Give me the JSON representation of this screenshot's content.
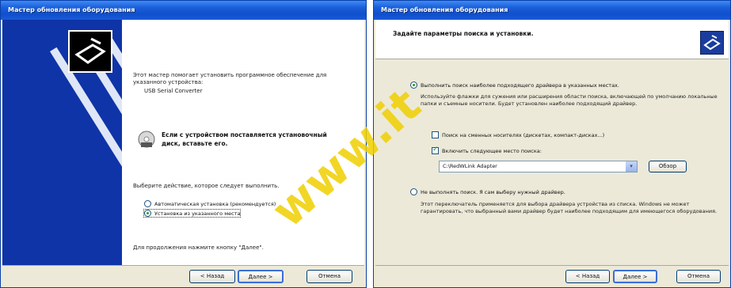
{
  "left_dialog": {
    "title": "Мастер обновления оборудования",
    "intro": "Этот мастер помогает установить программное обеспечение для указанного устройства:",
    "device": "USB Serial Converter",
    "cd_prompt": "Если с устройством поставляется установочный диск, вставьте его.",
    "choose_prompt": "Выберите действие, которое следует выполнить.",
    "options": [
      "Автоматическая установка (рекомендуется)",
      "Установка из указанного места"
    ],
    "next_hint": "Для продолжения нажмите кнопку \"Далее\".",
    "buttons": {
      "back": "< Назад",
      "next": "Далее >",
      "cancel": "Отмена"
    }
  },
  "right_dialog": {
    "title": "Мастер обновления оборудования",
    "header": "Задайте параметры поиска и установки.",
    "search_option": "Выполнить поиск наиболее подходящего драйвера в указанных местах.",
    "search_desc": "Используйте флажки для сужения или расширения области поиска, включающей по умолчанию локальные папки и съемные носители. Будет установлен наиболее подходящий драйвер.",
    "checkbox_removable": "Поиск на сменных носителях (дискетах, компакт-дисках...)",
    "checkbox_location": "Включить следующее место поиска:",
    "path_value": "C:\\RedWLink Adapter",
    "browse": "Обзор",
    "manual_option": "Не выполнять поиск. Я сам выберу нужный драйвер.",
    "manual_desc": "Этот переключатель применяется для выбора драйвера устройства из списка. Windows не может гарантировать, что выбранный вами драйвер будет наиболее подходящим для имеющегося оборудования.",
    "buttons": {
      "back": "< Назад",
      "next": "Далее >",
      "cancel": "Отмена"
    }
  },
  "watermark": "www.it"
}
